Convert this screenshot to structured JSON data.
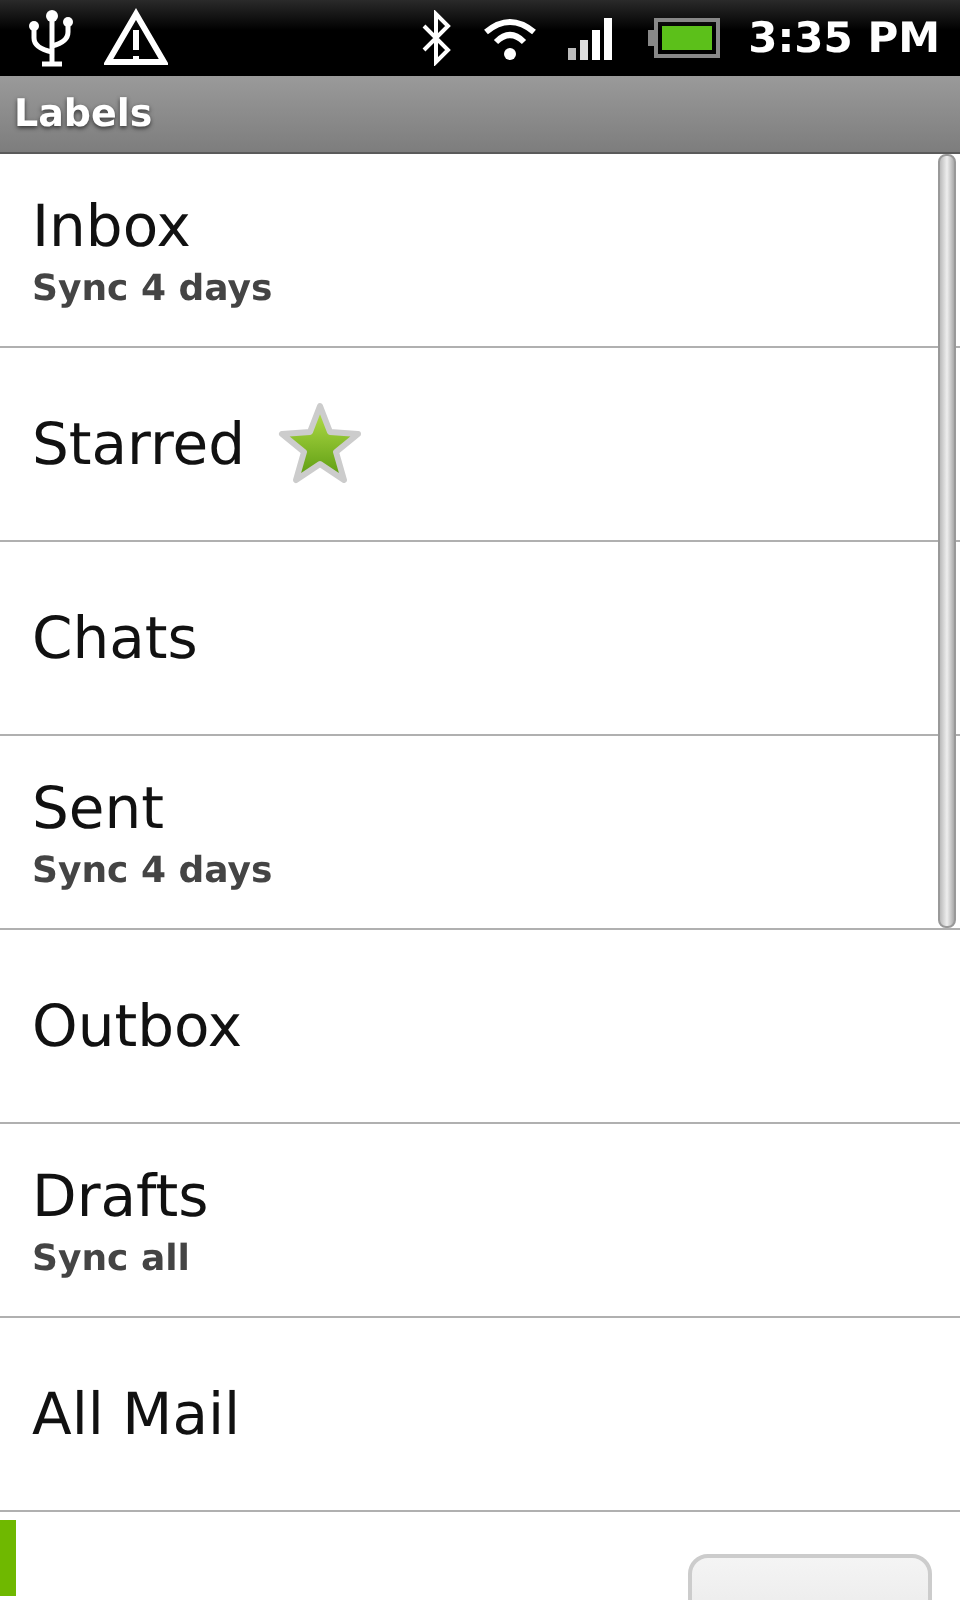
{
  "status_bar": {
    "time": "3:35 PM"
  },
  "header": {
    "title": "Labels"
  },
  "labels": [
    {
      "name": "Inbox",
      "sync": "Sync 4 days",
      "starred": false
    },
    {
      "name": "Starred",
      "starred": true
    },
    {
      "name": "Chats",
      "starred": false
    },
    {
      "name": "Sent",
      "sync": "Sync 4 days",
      "starred": false
    },
    {
      "name": "Outbox",
      "starred": false
    },
    {
      "name": "Drafts",
      "sync": "Sync all",
      "starred": false
    },
    {
      "name": "All Mail",
      "starred": false
    }
  ],
  "partial_row": {
    "color": "#6fb800"
  }
}
